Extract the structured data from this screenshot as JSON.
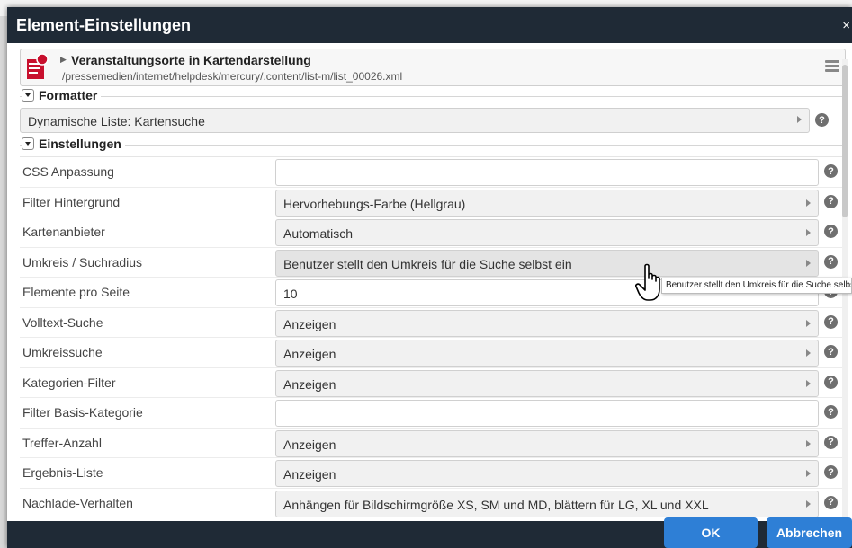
{
  "dialog": {
    "title": "Element-Einstellungen",
    "close_label": "×"
  },
  "header": {
    "title": "Veranstaltungsorte in Kartendarstellung",
    "path": "/pressemedien/internet/helpdesk/mercury/.content/list-m/list_00026.xml",
    "doc_icon": "document-icon",
    "menu_icon": "hamburger-menu-icon"
  },
  "formatter": {
    "section_label": "Formatter",
    "value": "Dynamische Liste: Kartensuche"
  },
  "settings": {
    "section_label": "Einstellungen",
    "rows": [
      {
        "label": "CSS Anpassung",
        "value": "",
        "type": "text"
      },
      {
        "label": "Filter Hintergrund",
        "value": "Hervorhebungs-Farbe (Hellgrau)",
        "type": "select"
      },
      {
        "label": "Kartenanbieter",
        "value": "Automatisch",
        "type": "select"
      },
      {
        "label": "Umkreis / Suchradius",
        "value": "Benutzer stellt den Umkreis für die Suche selbst ein",
        "type": "select"
      },
      {
        "label": "Elemente pro Seite",
        "value": "10",
        "type": "text"
      },
      {
        "label": "Volltext-Suche",
        "value": "Anzeigen",
        "type": "select"
      },
      {
        "label": "Umkreissuche",
        "value": "Anzeigen",
        "type": "select"
      },
      {
        "label": "Kategorien-Filter",
        "value": "Anzeigen",
        "type": "select"
      },
      {
        "label": "Filter Basis-Kategorie",
        "value": "",
        "type": "text"
      },
      {
        "label": "Treffer-Anzahl",
        "value": "Anzeigen",
        "type": "select"
      },
      {
        "label": "Ergebnis-Liste",
        "value": "Anzeigen",
        "type": "select"
      },
      {
        "label": "Nachlade-Verhalten",
        "value": "Anhängen für Bildschirmgröße XS, SM und MD, blättern für LG, XL und XXL",
        "type": "select"
      }
    ]
  },
  "help_symbol": "?",
  "tooltip": "Benutzer stellt den Umkreis für die Suche selbst ein",
  "buttons": {
    "ok": "OK",
    "cancel": "Abbrechen"
  },
  "colors": {
    "titlebar": "#1f2a36",
    "primary_button": "#2e7fd6",
    "doc_icon_red": "#c8102e"
  }
}
